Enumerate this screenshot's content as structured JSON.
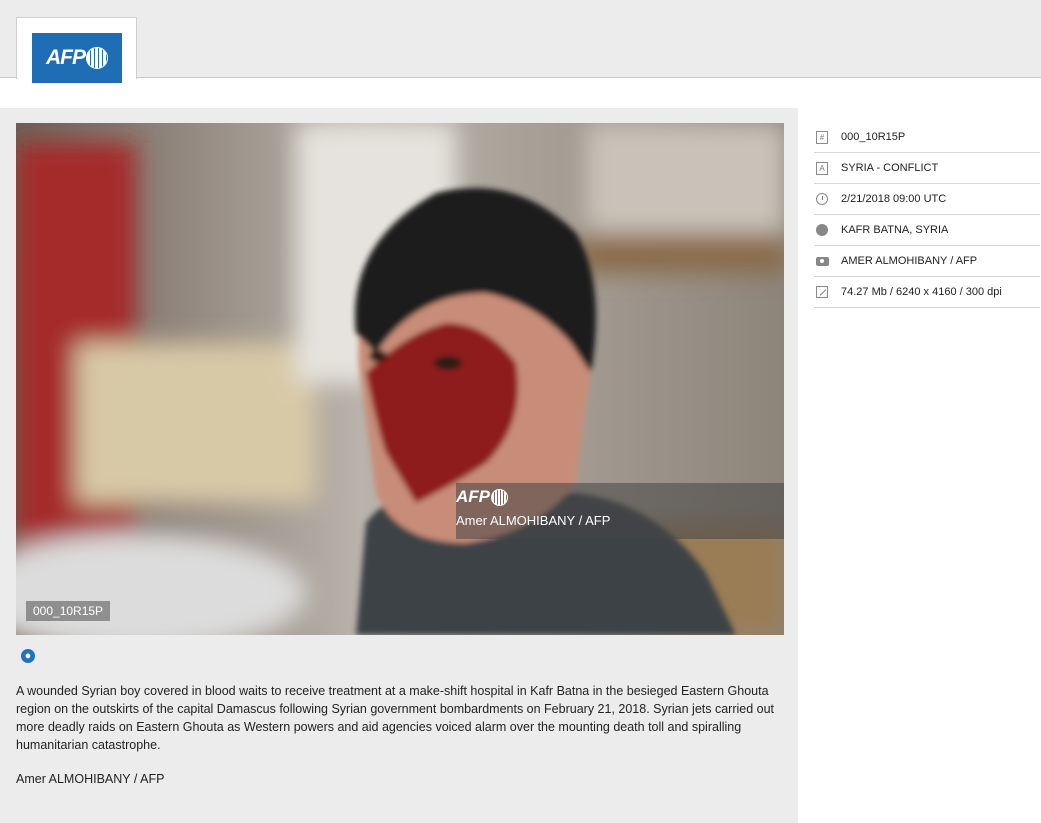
{
  "header": {
    "logo_text": "AFP"
  },
  "photo": {
    "id_tag": "000_10R15P",
    "watermark_logo": "AFP",
    "watermark_credit": "Amer ALMOHIBANY / AFP"
  },
  "caption": "A wounded Syrian boy covered in blood waits to receive treatment at a make-shift hospital in Kafr Batna in the besieged Eastern Ghouta region on the outskirts of the capital Damascus following Syrian government bombardments on February 21, 2018. Syrian jets carried out more deadly raids on Eastern Ghouta as Western powers and aid agencies voiced alarm over the mounting death toll and spiralling humanitarian catastrophe.",
  "credit": "Amer ALMOHIBANY / AFP",
  "metadata": [
    {
      "icon": "hash-icon",
      "value": "000_10R15P"
    },
    {
      "icon": "text-icon",
      "value": "SYRIA - CONFLICT"
    },
    {
      "icon": "clock-icon",
      "value": "2/21/2018 09:00 UTC"
    },
    {
      "icon": "globe-icon",
      "value": "KAFR BATNA, SYRIA"
    },
    {
      "icon": "camera-icon",
      "value": "AMER ALMOHIBANY / AFP"
    },
    {
      "icon": "resize-icon",
      "value": "74.27 Mb / 6240 x 4160 / 300 dpi"
    }
  ],
  "colors": {
    "brand": "#1f6db5",
    "panel": "#ececec"
  }
}
